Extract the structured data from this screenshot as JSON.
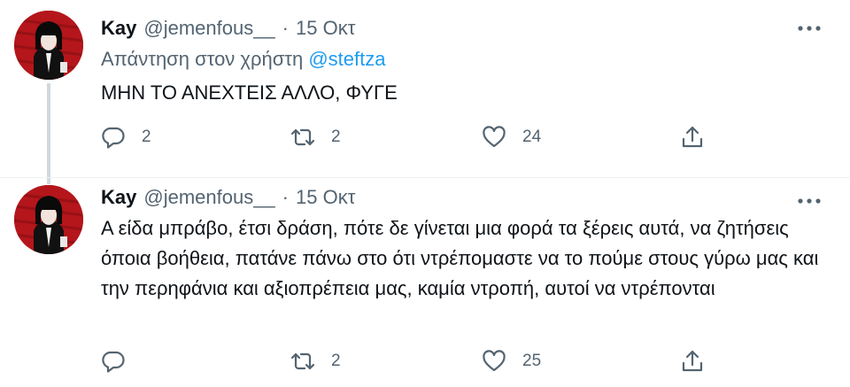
{
  "tweets": [
    {
      "author_name": "Kay",
      "author_handle": "@jemenfous__",
      "separator": "·",
      "date": "15 Οκτ",
      "reply_prefix": "Απάντηση στον χρήστη",
      "reply_mention": "@steftza",
      "text": "ΜΗΝ ΤΟ ΑΝΕΧΤΕΙΣ ΑΛΛΟ, ΦΥΓΕ",
      "actions": {
        "reply_count": "2",
        "retweet_count": "2",
        "like_count": "24"
      }
    },
    {
      "author_name": "Kay",
      "author_handle": "@jemenfous__",
      "separator": "·",
      "date": "15 Οκτ",
      "text": "Α είδα μπράβο, έτσι δράση, πότε δε γίνεται μια φορά τα ξέρεις αυτά, να ζητήσεις όποια βοήθεια, πατάνε πάνω στο ότι ντρέπομαστε να το πούμε στους γύρω μας και την περηφάνια και αξιοπρέπεια μας, καμία ντροπή, αυτοί να ντρέπονται",
      "actions": {
        "retweet_count": "2",
        "like_count": "25"
      }
    }
  ],
  "icons": {
    "reply": "reply-icon",
    "retweet": "retweet-icon",
    "like": "like-icon",
    "share": "share-icon",
    "more": "more-options-icon",
    "avatar": "avatar"
  },
  "colors": {
    "text": "#0f1419",
    "secondary": "#536471",
    "accent": "#1d9bf0",
    "thread_line": "#cfd9de",
    "avatar_bg": "#b4161b"
  }
}
